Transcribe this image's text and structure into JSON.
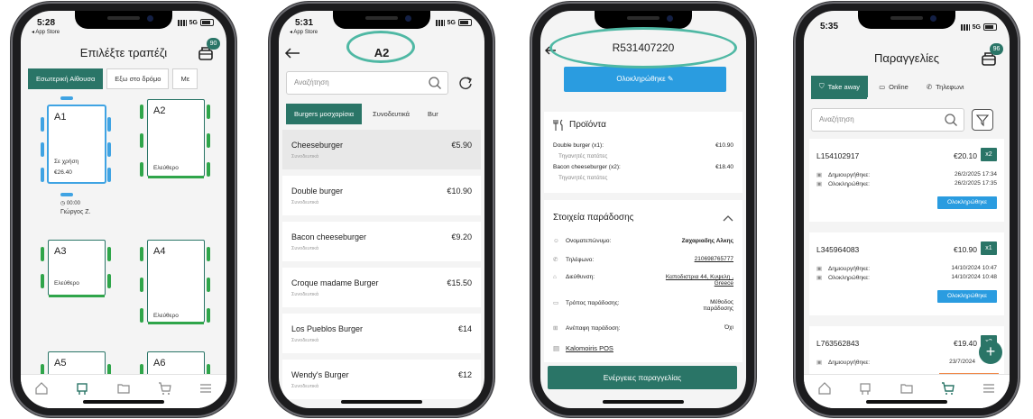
{
  "colors": {
    "primary": "#2a7567",
    "info": "#2a9ce0",
    "free": "#2fa54a",
    "busy": "#3fa3e3",
    "highlight_ring": "#4fb8a4"
  },
  "phone1": {
    "time": "5:28",
    "back_label": "◂ App Store",
    "network": "5G",
    "title": "Επιλέξτε τραπέζι",
    "cart_badge": "90",
    "tabs": [
      "Εσωτερική Αίθουσα",
      "Εξω στο δρόμο",
      "Με"
    ],
    "tables": [
      {
        "name": "A1",
        "status": "Σε χρήση",
        "amount": "€26.40",
        "timer": "◷ 00:00",
        "waiter": "Γιώργος Ζ."
      },
      {
        "name": "A2",
        "status": "Ελεύθερο"
      },
      {
        "name": "A3",
        "status": "Ελεύθερο"
      },
      {
        "name": "A4",
        "status": "Ελεύθερο"
      },
      {
        "name": "A5",
        "status": ""
      },
      {
        "name": "A6",
        "status": ""
      }
    ]
  },
  "phone2": {
    "time": "5:31",
    "back_label": "◂ App Store",
    "network": "5G",
    "title": "A2",
    "search_placeholder": "Αναζήτηση",
    "tabs": [
      "Burgers μοσχαρίσια",
      "Συνοδευτικά",
      "Bur"
    ],
    "products": [
      {
        "name": "Cheeseburger",
        "sub": "Συνοδευτικά",
        "price": "€5.90"
      },
      {
        "name": "Double burger",
        "sub": "Συνοδευτικά",
        "price": "€10.90"
      },
      {
        "name": "Bacon cheeseburger",
        "sub": "Συνοδευτικά",
        "price": "€9.20"
      },
      {
        "name": "Croque madame Burger",
        "sub": "Συνοδευτικά",
        "price": "€15.50"
      },
      {
        "name": "Los Pueblos Burger",
        "sub": "Συνοδευτικά",
        "price": "€14"
      },
      {
        "name": "Wendy's Burger",
        "sub": "Συνοδευτικά",
        "price": "€12"
      }
    ]
  },
  "phone3": {
    "title": "R531407220",
    "complete_btn": "Ολοκληρώθηκε ✎",
    "products_title": "Προϊόντα",
    "items": [
      {
        "name": "Double burger (x1):",
        "price": "€10.90",
        "side": "Τηγανητές πατάτες"
      },
      {
        "name": "Bacon cheeseburger (x2):",
        "price": "€18.40",
        "side": "Τηγανητές πατάτες"
      }
    ],
    "delivery_title": "Στοιχεία παράδοσης",
    "fields": [
      {
        "label": "Ονοματεπώνυμο:",
        "value": "Ζαχαριαδης Αλκης"
      },
      {
        "label": "Τηλέφωνο:",
        "value": "210698765777"
      },
      {
        "label": "Διεύθυνση:",
        "value": "Καποδιστρια 44, Κυψελη , Greece"
      },
      {
        "label": "Τρόπος παράδοσης:",
        "value": "Μέθοδος παράδοσης"
      },
      {
        "label": "Ανέπαφη παράδοση:",
        "value": "Όχι"
      }
    ],
    "pos_link": "Kalomoiris POS",
    "actions_btn": "Ενέργειες παραγγελίας"
  },
  "phone4": {
    "time": "5:35",
    "network": "5G",
    "title": "Παραγγελίες",
    "cart_badge": "96",
    "tabs": [
      "Take away",
      "Online",
      "Τηλεφωνι"
    ],
    "search_placeholder": "Αναζήτηση",
    "orders": [
      {
        "id": "L154102917",
        "amount": "€20.10",
        "qty": "x2",
        "created_label": "Δημιουργήθηκε:",
        "created": "26/2/2025 17:34",
        "done_label": "Ολοκληρώθηκε:",
        "done": "26/2/2025 17:35",
        "status": "Ολοκληρώθηκε"
      },
      {
        "id": "L345964083",
        "amount": "€10.90",
        "qty": "x1",
        "created_label": "Δημιουργήθηκε:",
        "created": "14/10/2024 10:47",
        "done_label": "Ολοκληρώθηκε:",
        "done": "14/10/2024 10:48",
        "status": "Ολοκληρώθηκε"
      },
      {
        "id": "L763562843",
        "amount": "€19.40",
        "qty": "x2",
        "created_label": "Δημιουργήθηκε:",
        "created": "23/7/2024"
      }
    ]
  }
}
